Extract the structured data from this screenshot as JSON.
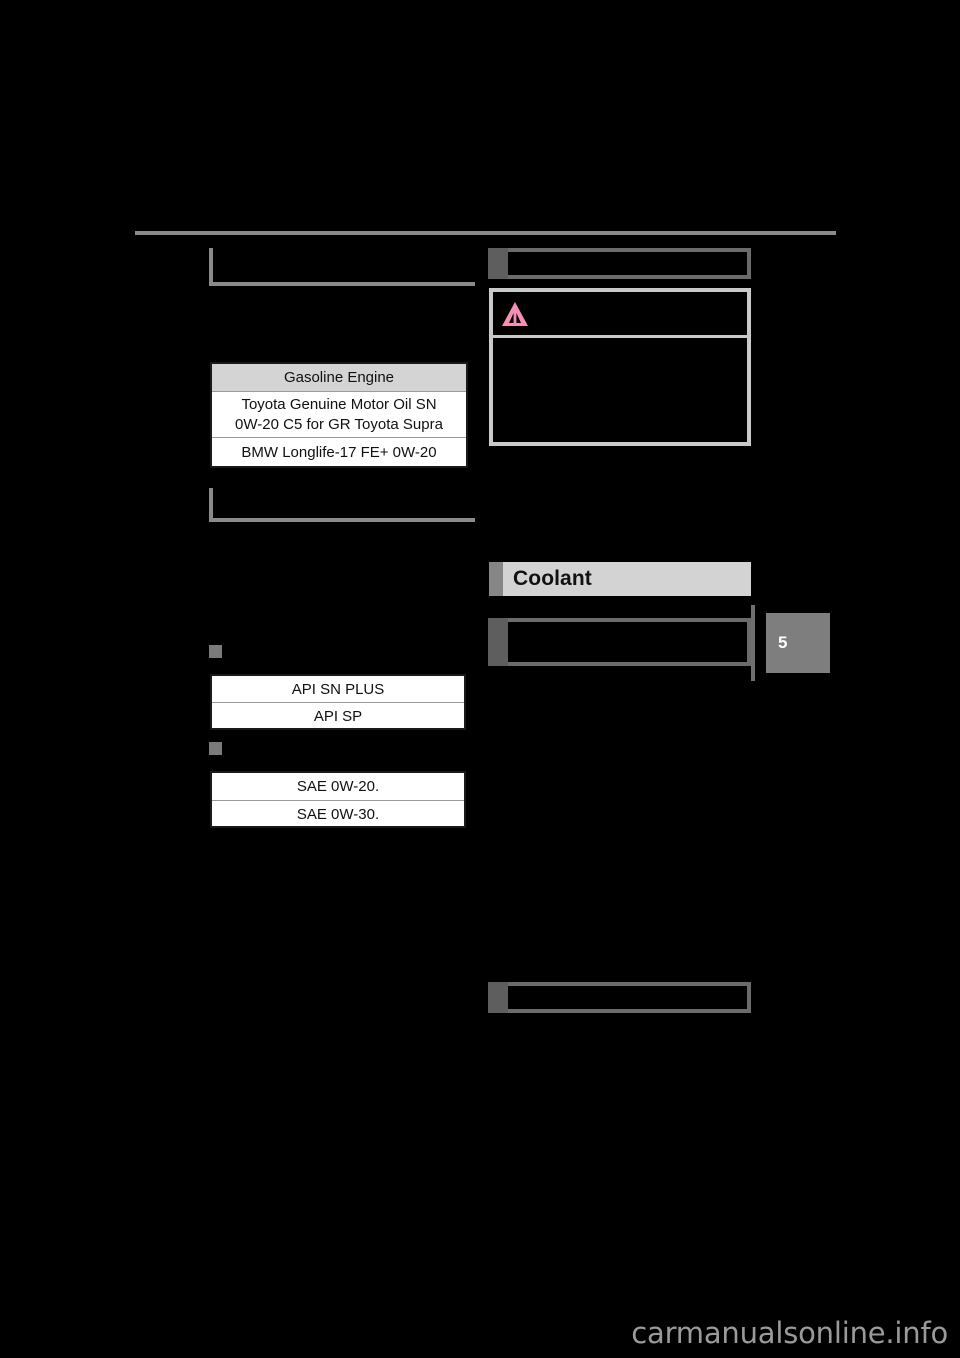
{
  "document": {
    "page_number": "5",
    "watermark": "carmanualsonline.info",
    "section_heading": "Coolant"
  },
  "colors": {
    "background": "#000000",
    "rule": "#8a8a8a",
    "table_border": "#1a1a1a",
    "table_header_fill": "#d4d4d4",
    "table_cell_fill": "#ffffff",
    "subhead_tab": "#5e5e5e",
    "subhead_border": "#6b6b6b",
    "section_heading_fill": "#d3d3d3",
    "section_heading_tab": "#868686",
    "warning_border": "#c9c9c9",
    "warning_triangle": "#f58fb5",
    "page_tab": "#7e7e7e",
    "marker": "#7b7b7b",
    "watermark": "#9a9a9a"
  },
  "left_column": {
    "oil_table": {
      "header": "Gasoline Engine",
      "rows": [
        "Toyota Genuine Motor Oil SN\n0W-20 C5 for GR Toyota Supra",
        "BMW Longlife-17 FE+ 0W-20"
      ],
      "row_line_1": "Toyota Genuine Motor Oil SN",
      "row_line_2": "0W-20 C5 for GR Toyota Supra",
      "row_2": "BMW Longlife-17 FE+ 0W-20"
    },
    "api_table": {
      "rows": [
        "API SN PLUS",
        "API SP"
      ]
    },
    "sae_table": {
      "rows": [
        "SAE 0W-20.",
        "SAE 0W-30."
      ]
    },
    "markers": [
      "grade-marker-api",
      "grade-marker-sae"
    ],
    "brackets": [
      "bracket-upper",
      "bracket-lower"
    ]
  },
  "right_column": {
    "subheads": [
      {
        "name": "subhead-top",
        "label": ""
      },
      {
        "name": "subhead-coolant-type",
        "label": ""
      },
      {
        "name": "subhead-bottom",
        "label": ""
      }
    ],
    "warning_box": {
      "icon": "warning-triangle-icon",
      "title": "",
      "body": ""
    }
  }
}
